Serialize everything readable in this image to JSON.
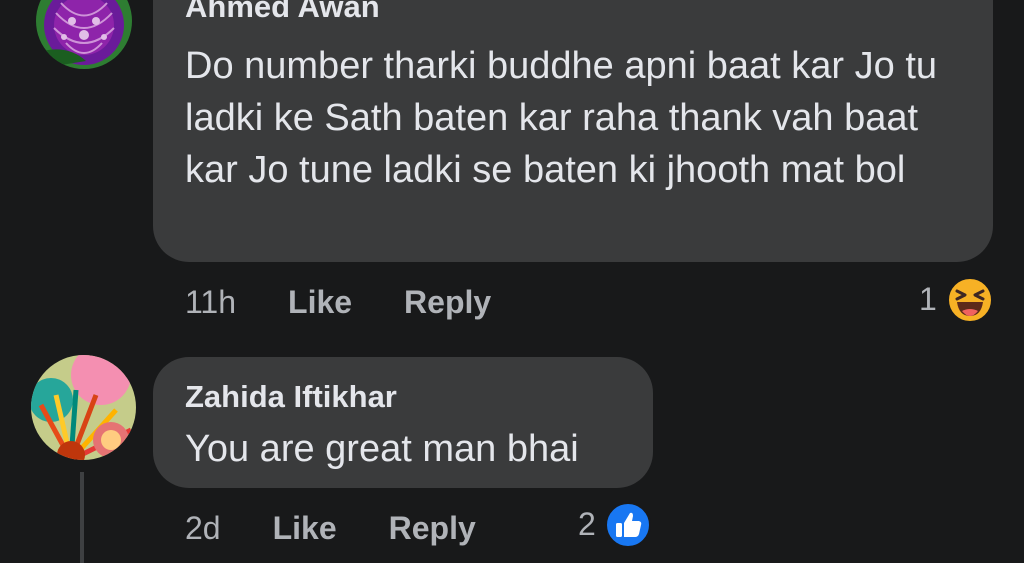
{
  "comments": [
    {
      "author": "Ahmed Awan",
      "text": "Do number tharki buddhe apni baat kar Jo tu ladki ke Sath baten kar raha thank vah baat kar Jo tune ladki se baten ki jhooth mat bol",
      "time": "11h",
      "like_label": "Like",
      "reply_label": "Reply",
      "reaction_count": "1",
      "reaction_icon": "haha-emoji-icon"
    },
    {
      "author": "Zahida Iftikhar",
      "text": "You are great man bhai",
      "time": "2d",
      "like_label": "Like",
      "reply_label": "Reply",
      "reaction_count": "2",
      "reaction_icon": "like-thumb-icon"
    }
  ],
  "colors": {
    "background": "#18191a",
    "bubble": "#3a3b3c",
    "text_primary": "#e4e6eb",
    "text_secondary": "#b0b3b8",
    "like_blue": "#1877f2",
    "haha_yellow": "#f7b125"
  }
}
